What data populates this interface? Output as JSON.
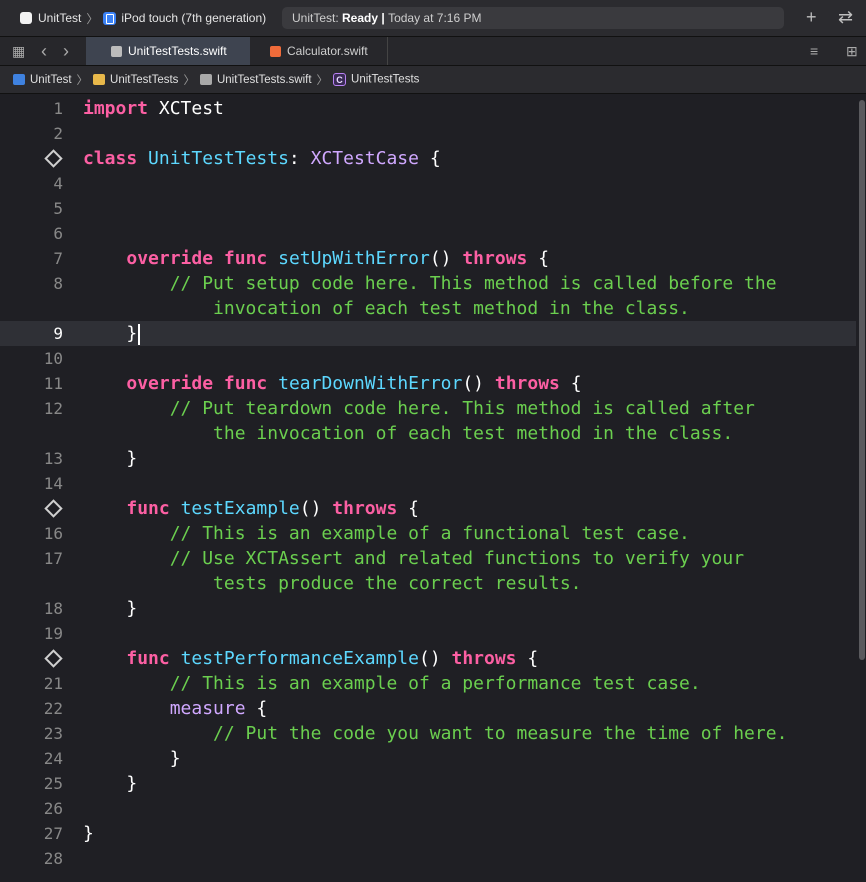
{
  "toolbar": {
    "scheme": "UnitTest",
    "scheme_sep": "〉",
    "device": "iPod touch (7th generation)",
    "status_prefix": "UnitTest: ",
    "status_state": "Ready",
    "status_divider": " | ",
    "status_time": "Today at 7:16 PM",
    "add_symbol": "+",
    "swap_symbol": "⇄"
  },
  "tabbar": {
    "grid_symbol": "▦",
    "back_symbol": "‹",
    "forward_symbol": "›",
    "tabs": [
      {
        "label": "UnitTestTests.swift"
      },
      {
        "label": "Calculator.swift"
      }
    ],
    "menu_symbol": "≡",
    "add_editor_symbol": "⊞"
  },
  "jumpbar": {
    "sep": "〉",
    "items": [
      "UnitTest",
      "UnitTestTests",
      "UnitTestTests.swift",
      "UnitTestTests"
    ],
    "class_letter": "C"
  },
  "editor": {
    "current_line": 9,
    "lines": [
      {
        "n": "1",
        "tokens": [
          [
            "kw",
            "import"
          ],
          [
            "pl",
            " XCTest"
          ]
        ]
      },
      {
        "n": "2",
        "tokens": []
      },
      {
        "n": "",
        "diamond": true,
        "tokens": [
          [
            "kw",
            "class"
          ],
          [
            "pl",
            " "
          ],
          [
            "fn",
            "UnitTestTests"
          ],
          [
            "pl",
            ": "
          ],
          [
            "ty",
            "XCTestCase"
          ],
          [
            "pl",
            " {"
          ]
        ]
      },
      {
        "n": "4",
        "tokens": []
      },
      {
        "n": "5",
        "tokens": []
      },
      {
        "n": "6",
        "tokens": []
      },
      {
        "n": "7",
        "tokens": [
          [
            "pl",
            "    "
          ],
          [
            "kw",
            "override"
          ],
          [
            "pl",
            " "
          ],
          [
            "kw",
            "func"
          ],
          [
            "pl",
            " "
          ],
          [
            "fn",
            "setUpWithError"
          ],
          [
            "pl",
            "() "
          ],
          [
            "kw",
            "throws"
          ],
          [
            "pl",
            " {"
          ]
        ]
      },
      {
        "n": "8",
        "tokens": [
          [
            "pl",
            "        "
          ],
          [
            "cm",
            "// Put setup code here. This method is called before the"
          ]
        ]
      },
      {
        "n": "",
        "tokens": [
          [
            "pl",
            "            "
          ],
          [
            "cm",
            "invocation of each test method in the class."
          ]
        ]
      },
      {
        "n": "9",
        "current": true,
        "caret": true,
        "tokens": [
          [
            "pl",
            "    }"
          ]
        ]
      },
      {
        "n": "10",
        "tokens": []
      },
      {
        "n": "11",
        "tokens": [
          [
            "pl",
            "    "
          ],
          [
            "kw",
            "override"
          ],
          [
            "pl",
            " "
          ],
          [
            "kw",
            "func"
          ],
          [
            "pl",
            " "
          ],
          [
            "fn",
            "tearDownWithError"
          ],
          [
            "pl",
            "() "
          ],
          [
            "kw",
            "throws"
          ],
          [
            "pl",
            " {"
          ]
        ]
      },
      {
        "n": "12",
        "tokens": [
          [
            "pl",
            "        "
          ],
          [
            "cm",
            "// Put teardown code here. This method is called after"
          ]
        ]
      },
      {
        "n": "",
        "tokens": [
          [
            "pl",
            "            "
          ],
          [
            "cm",
            "the invocation of each test method in the class."
          ]
        ]
      },
      {
        "n": "13",
        "tokens": [
          [
            "pl",
            "    }"
          ]
        ]
      },
      {
        "n": "14",
        "tokens": []
      },
      {
        "n": "",
        "diamond": true,
        "tokens": [
          [
            "pl",
            "    "
          ],
          [
            "kw",
            "func"
          ],
          [
            "pl",
            " "
          ],
          [
            "fn",
            "testExample"
          ],
          [
            "pl",
            "() "
          ],
          [
            "kw",
            "throws"
          ],
          [
            "pl",
            " {"
          ]
        ]
      },
      {
        "n": "16",
        "tokens": [
          [
            "pl",
            "        "
          ],
          [
            "cm",
            "// This is an example of a functional test case."
          ]
        ]
      },
      {
        "n": "17",
        "tokens": [
          [
            "pl",
            "        "
          ],
          [
            "cm",
            "// Use XCTAssert and related functions to verify your"
          ]
        ]
      },
      {
        "n": "",
        "tokens": [
          [
            "pl",
            "            "
          ],
          [
            "cm",
            "tests produce the correct results."
          ]
        ]
      },
      {
        "n": "18",
        "tokens": [
          [
            "pl",
            "    }"
          ]
        ]
      },
      {
        "n": "19",
        "tokens": []
      },
      {
        "n": "",
        "diamond": true,
        "tokens": [
          [
            "pl",
            "    "
          ],
          [
            "kw",
            "func"
          ],
          [
            "pl",
            " "
          ],
          [
            "fn",
            "testPerformanceExample"
          ],
          [
            "pl",
            "() "
          ],
          [
            "kw",
            "throws"
          ],
          [
            "pl",
            " {"
          ]
        ]
      },
      {
        "n": "21",
        "tokens": [
          [
            "pl",
            "        "
          ],
          [
            "cm",
            "// This is an example of a performance test case."
          ]
        ]
      },
      {
        "n": "22",
        "tokens": [
          [
            "pl",
            "        "
          ],
          [
            "ty",
            "measure"
          ],
          [
            "pl",
            " {"
          ]
        ]
      },
      {
        "n": "23",
        "tokens": [
          [
            "pl",
            "            "
          ],
          [
            "cm",
            "// Put the code you want to measure the time of here."
          ]
        ]
      },
      {
        "n": "24",
        "tokens": [
          [
            "pl",
            "        }"
          ]
        ]
      },
      {
        "n": "25",
        "tokens": [
          [
            "pl",
            "    }"
          ]
        ]
      },
      {
        "n": "26",
        "tokens": []
      },
      {
        "n": "27",
        "tokens": [
          [
            "pl",
            "}"
          ]
        ]
      },
      {
        "n": "28",
        "tokens": []
      }
    ]
  }
}
